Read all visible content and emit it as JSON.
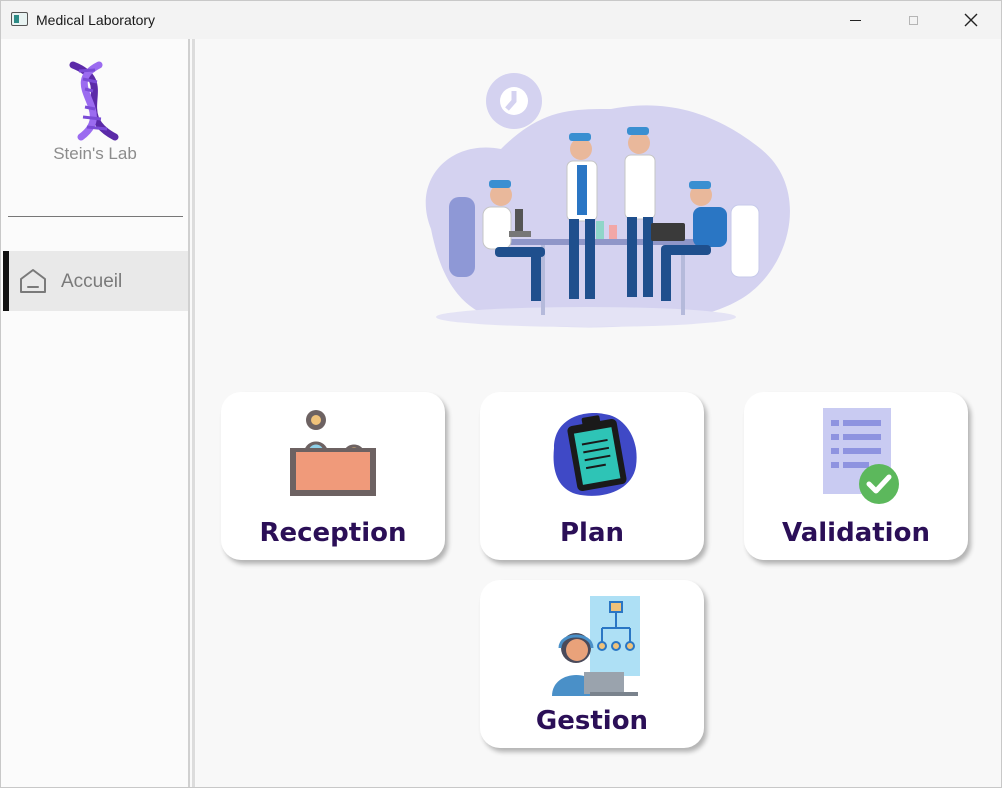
{
  "window": {
    "title": "Medical Laboratory"
  },
  "sidebar": {
    "brand": "Stein's Lab",
    "items": [
      {
        "label": "Accueil",
        "icon": "home-icon",
        "active": true
      }
    ]
  },
  "main": {
    "hero_image": "lab-team-illustration",
    "cards": [
      {
        "label": "Reception",
        "icon": "reception-desk-icon"
      },
      {
        "label": "Plan",
        "icon": "clipboard-icon"
      },
      {
        "label": "Validation",
        "icon": "document-check-icon"
      },
      {
        "label": "Gestion",
        "icon": "management-flowchart-icon"
      }
    ]
  },
  "colors": {
    "card_label": "#2b0f57",
    "dna_purple": "#7a4bd6",
    "accent_blue": "#3f49c6",
    "check_green": "#5cb85c"
  }
}
